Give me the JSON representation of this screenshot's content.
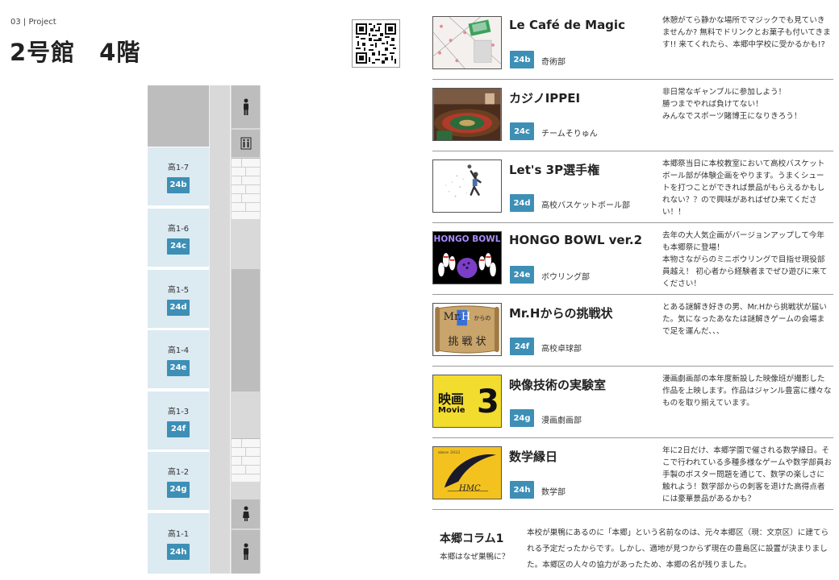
{
  "header": {
    "kicker": "03 | Project",
    "title": "2号館　4階"
  },
  "floor_map": {
    "rooms": [
      {
        "name": "高1-7",
        "badge": "24b"
      },
      {
        "name": "高1-6",
        "badge": "24c"
      },
      {
        "name": "高1-5",
        "badge": "24d"
      },
      {
        "name": "高1-4",
        "badge": "24e"
      },
      {
        "name": "高1-3",
        "badge": "24f"
      },
      {
        "name": "高1-2",
        "badge": "24g"
      },
      {
        "name": "高1-1",
        "badge": "24h"
      }
    ],
    "icons": [
      "restroom-man-icon",
      "restroom-accessible-icon",
      "restroom-woman-icon",
      "restroom-man-icon"
    ]
  },
  "projects": [
    {
      "title": "Le Café de Magic",
      "badge": "24b",
      "org": "奇術部",
      "desc": "休憩がてら静かな場所でマジックでも見ていきませんか? 無料でドリンクとお菓子も付いてきます!! 来てくれたら、本郷中学校に受かるかも!?",
      "thumb": "magic-poster"
    },
    {
      "title": "カジノIPPEI",
      "badge": "24c",
      "org": "チームそりゅん",
      "desc": "非日常なギャンブルに参加しよう！\n勝つまでやれば負けてない！\nみんなでスポーツ賭博王になりきろう！",
      "thumb": "casino-roulette-photo"
    },
    {
      "title": "Let's 3P選手権",
      "badge": "24d",
      "org": "高校バスケットボール部",
      "desc": "本郷祭当日に本校教室において高校バスケットボール部が体験企画をやります。うまくシュートを打つことができれば景品がもらえるかもしれない？？ので興味があればぜひ来てください！！",
      "thumb": "basketball-player-illustration"
    },
    {
      "title": "HONGO BOWL ver.2",
      "badge": "24e",
      "org": "ボウリング部",
      "desc": "去年の大人気企画がバージョンアップして今年も本郷祭に登場！\n本物さながらのミニボウリングで目指せ現役部員越え！ 初心者から経験者までぜひ遊びに来てください！",
      "thumb_text": "HONGO BOWL"
    },
    {
      "title": "Mr.Hからの挑戦状",
      "badge": "24f",
      "org": "高校卓球部",
      "desc": "とある謎解き好きの男、Mr.Hから挑戦状が届いた。気になったあなたは謎解きゲームの会場まで足を運んだ、、、",
      "thumb_text": [
        "Mr.",
        "H",
        "からの",
        "挑 戦 状"
      ]
    },
    {
      "title": "映像技術の実験室",
      "badge": "24g",
      "org": "漫画劇画部",
      "desc": "漫画劇画部の本年度新設した映像班が撮影した作品を上映します。作品はジャンル豊富に様々なものを取り揃えています。",
      "thumb_text": [
        "映画",
        "Movie",
        "3"
      ]
    },
    {
      "title": "数学縁日",
      "badge": "24h",
      "org": "数学部",
      "desc": "年に2日だけ、本郷学園で催される数学縁日。そこで行われている多種多様なゲームや数学部員お手製のポスター問題を通じて、数学の楽しさに触れよう！数学部からの刺客を退けた高得点者には豪華景品があるかも？",
      "thumb_text": [
        "since 2022",
        "HMC"
      ]
    }
  ],
  "column": {
    "title": "本郷コラム1",
    "subtitle": "本郷はなぜ巣鴨に？",
    "body": "本校が巣鴨にあるのに「本郷」という名前なのは、元々本郷区（現：文京区）に建てられる予定だったからです。しかし、適地が見つからず現在の豊島区に設置が決まりました。本郷区の人々の協力があったため、本郷の名が残りました。"
  },
  "colors": {
    "badge": "#3d8fb6",
    "room": "#dceaf2",
    "wall": "#bdbdbd",
    "corridor": "#d9d9d9",
    "movie_yellow": "#f2dc2e",
    "math_yellow": "#f4c21f",
    "bowl_purple": "#7b3fc7"
  }
}
